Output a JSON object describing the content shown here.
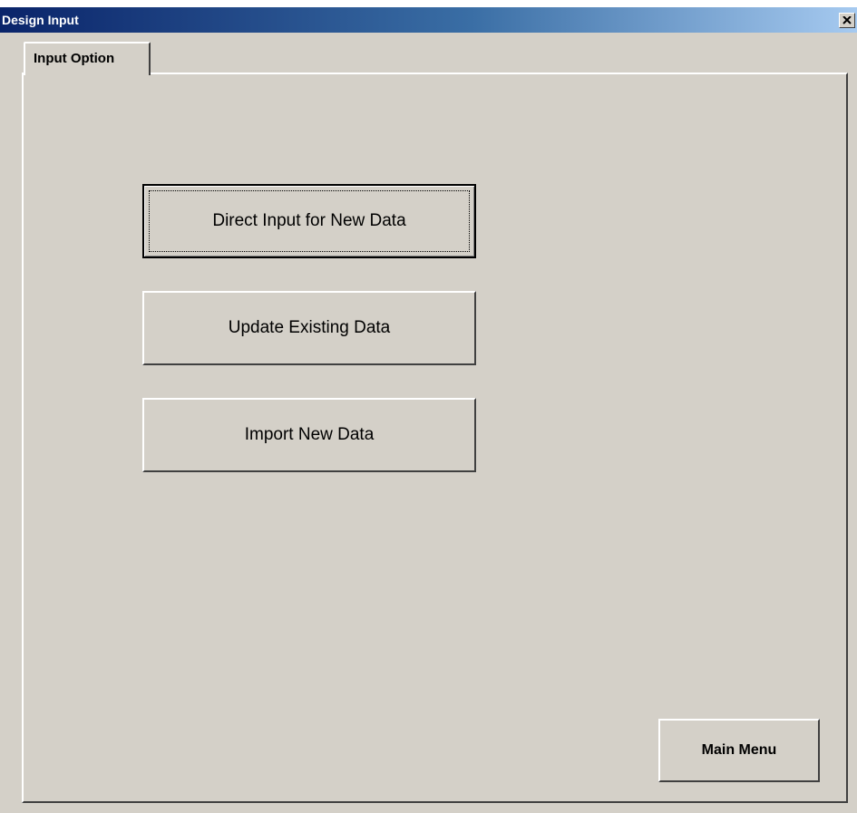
{
  "window": {
    "title": "Design Input",
    "close_symbol": "×",
    "close_icon": "close-icon"
  },
  "tabs": [
    {
      "label": "Input Option",
      "selected": true
    }
  ],
  "actions": {
    "direct_input": "Direct Input for New Data",
    "update_existing": "Update Existing Data",
    "import_new": "Import New Data",
    "main_menu": "Main Menu"
  },
  "colors": {
    "face": "#d4d0c8",
    "title_start": "#0a246a",
    "title_end": "#a6caf0"
  }
}
